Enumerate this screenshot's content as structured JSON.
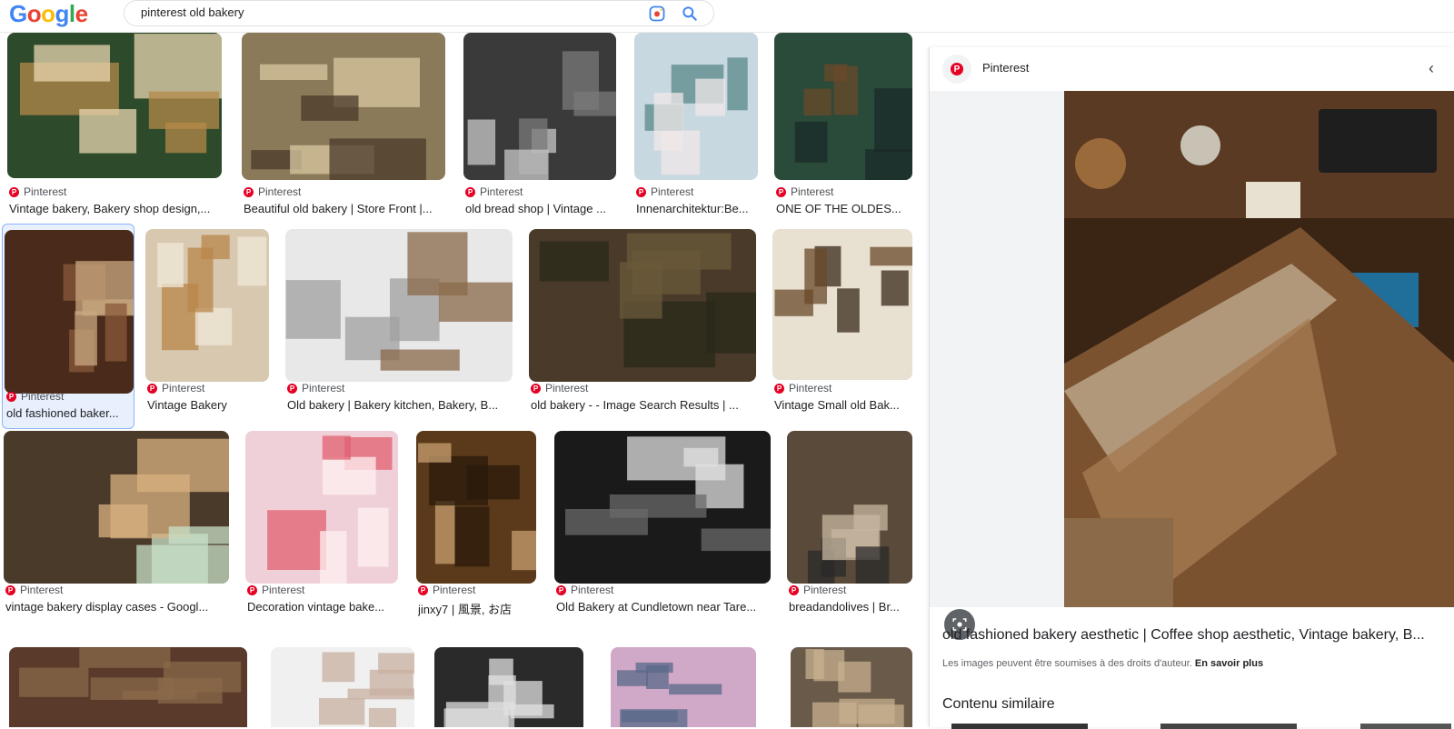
{
  "header": {
    "logo_letters": [
      "G",
      "o",
      "o",
      "g",
      "l",
      "e"
    ],
    "search_value": "pinterest old bakery",
    "lens_icon": "google-lens-icon",
    "search_icon": "search-icon"
  },
  "results": [
    {
      "source": "Pinterest",
      "caption": "Vintage bakery, Bakery shop design,..."
    },
    {
      "source": "Pinterest",
      "caption": "Beautiful old bakery | Store Front |..."
    },
    {
      "source": "Pinterest",
      "caption": "old bread shop | Vintage ..."
    },
    {
      "source": "Pinterest",
      "caption": "Innenarchitektur:Be..."
    },
    {
      "source": "Pinterest",
      "caption": "ONE OF THE OLDES..."
    },
    {
      "source": "Pinterest",
      "caption": "old fashioned baker..."
    },
    {
      "source": "Pinterest",
      "caption": "Vintage Bakery"
    },
    {
      "source": "Pinterest",
      "caption": "Old bakery | Bakery kitchen, Bakery, B..."
    },
    {
      "source": "Pinterest",
      "caption": "old bakery - - Image Search Results | ..."
    },
    {
      "source": "Pinterest",
      "caption": "Vintage Small old Bak..."
    },
    {
      "source": "Pinterest",
      "caption": "vintage bakery display cases - Googl..."
    },
    {
      "source": "Pinterest",
      "caption": "Decoration vintage bake..."
    },
    {
      "source": "Pinterest",
      "caption": "jinxy7 | 風景, お店"
    },
    {
      "source": "Pinterest",
      "caption": "Old Bakery at Cundletown near Tare..."
    },
    {
      "source": "Pinterest",
      "caption": "breadandolives | Br..."
    }
  ],
  "panel": {
    "source": "Pinterest",
    "title": "old fashioned bakery aesthetic | Coffee shop aesthetic, Vintage bakery, B...",
    "rights_text": "Les images peuvent être soumises à des droits d'auteur.",
    "rights_link": "En savoir plus",
    "related_heading": "Contenu similaire",
    "colors": {
      "pinterest": "#e60023",
      "selected_border": "#8ab4f8"
    }
  }
}
